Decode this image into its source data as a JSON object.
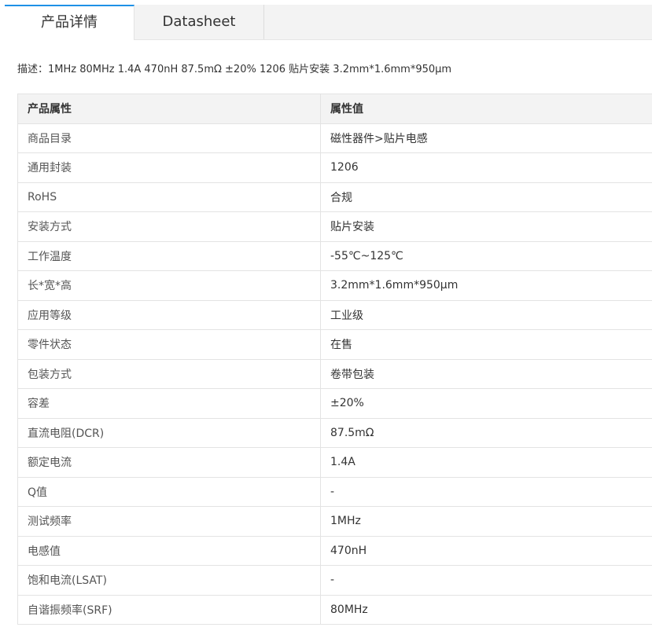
{
  "tabs": [
    {
      "label": "产品详情",
      "active": true
    },
    {
      "label": "Datasheet",
      "active": false
    }
  ],
  "colors": {
    "accent": "#1e90e6",
    "header_bg": "#f3f3f3",
    "border": "#e3e3e3"
  },
  "description": "描述：1MHz 80MHz 1.4A 470nH 87.5mΩ ±20% 1206 贴片安装 3.2mm*1.6mm*950μm",
  "table": {
    "headers": {
      "attribute": "产品属性",
      "value": "属性值"
    },
    "rows": [
      {
        "k": "商品目录",
        "v": "磁性器件>贴片电感"
      },
      {
        "k": "通用封装",
        "v": "1206"
      },
      {
        "k": "RoHS",
        "v": "合规"
      },
      {
        "k": "安装方式",
        "v": "贴片安装"
      },
      {
        "k": "工作温度",
        "v": "-55℃~125℃"
      },
      {
        "k": "长*宽*高",
        "v": "3.2mm*1.6mm*950μm"
      },
      {
        "k": "应用等级",
        "v": "工业级"
      },
      {
        "k": "零件状态",
        "v": "在售"
      },
      {
        "k": "包装方式",
        "v": "卷带包装"
      },
      {
        "k": "容差",
        "v": "±20%"
      },
      {
        "k": "直流电阻(DCR)",
        "v": "87.5mΩ"
      },
      {
        "k": "额定电流",
        "v": "1.4A"
      },
      {
        "k": "Q值",
        "v": "-"
      },
      {
        "k": "测试频率",
        "v": "1MHz"
      },
      {
        "k": "电感值",
        "v": "470nH"
      },
      {
        "k": "饱和电流(LSAT)",
        "v": "-"
      },
      {
        "k": "自谐振频率(SRF)",
        "v": "80MHz"
      }
    ]
  }
}
